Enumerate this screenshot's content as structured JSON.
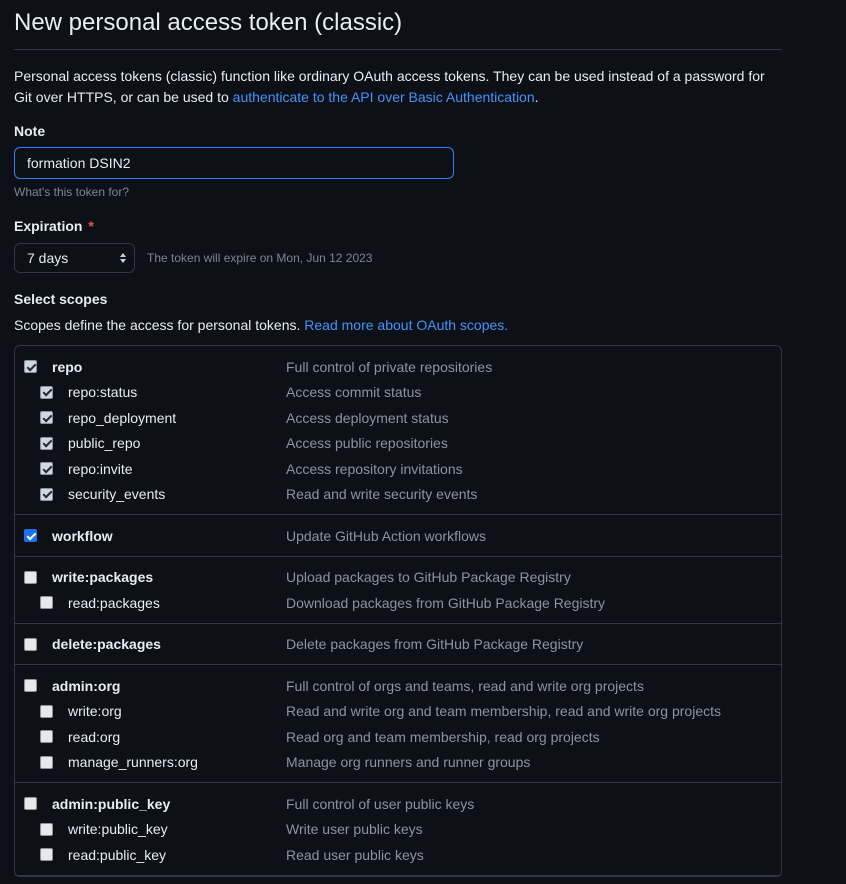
{
  "page": {
    "title": "New personal access token (classic)",
    "intro_text": "Personal access tokens (classic) function like ordinary OAuth access tokens. They can be used instead of a password for Git over HTTPS, or can be used to ",
    "intro_link": "authenticate to the API over Basic Authentication",
    "intro_end": "."
  },
  "note": {
    "label": "Note",
    "value": "formation DSIN2",
    "hint": "What's this token for?"
  },
  "expiration": {
    "label": "Expiration",
    "required_mark": "*",
    "selected": "7 days",
    "note": "The token will expire on Mon, Jun 12 2023"
  },
  "scopes": {
    "label": "Select scopes",
    "desc": "Scopes define the access for personal tokens. ",
    "link": "Read more about OAuth scopes.",
    "groups": [
      {
        "parent": {
          "name": "repo",
          "desc": "Full control of private repositories",
          "checked": true
        },
        "children": [
          {
            "name": "repo:status",
            "desc": "Access commit status",
            "checked": true
          },
          {
            "name": "repo_deployment",
            "desc": "Access deployment status",
            "checked": true
          },
          {
            "name": "public_repo",
            "desc": "Access public repositories",
            "checked": true
          },
          {
            "name": "repo:invite",
            "desc": "Access repository invitations",
            "checked": true
          },
          {
            "name": "security_events",
            "desc": "Read and write security events",
            "checked": true
          }
        ]
      },
      {
        "parent": {
          "name": "workflow",
          "desc": "Update GitHub Action workflows",
          "checked": true,
          "active": true
        },
        "children": []
      },
      {
        "parent": {
          "name": "write:packages",
          "desc": "Upload packages to GitHub Package Registry",
          "checked": false
        },
        "children": [
          {
            "name": "read:packages",
            "desc": "Download packages from GitHub Package Registry",
            "checked": false
          }
        ]
      },
      {
        "parent": {
          "name": "delete:packages",
          "desc": "Delete packages from GitHub Package Registry",
          "checked": false
        },
        "children": []
      },
      {
        "parent": {
          "name": "admin:org",
          "desc": "Full control of orgs and teams, read and write org projects",
          "checked": false
        },
        "children": [
          {
            "name": "write:org",
            "desc": "Read and write org and team membership, read and write org projects",
            "checked": false
          },
          {
            "name": "read:org",
            "desc": "Read org and team membership, read org projects",
            "checked": false
          },
          {
            "name": "manage_runners:org",
            "desc": "Manage org runners and runner groups",
            "checked": false
          }
        ]
      },
      {
        "parent": {
          "name": "admin:public_key",
          "desc": "Full control of user public keys",
          "checked": false
        },
        "children": [
          {
            "name": "write:public_key",
            "desc": "Write user public keys",
            "checked": false
          },
          {
            "name": "read:public_key",
            "desc": "Read user public keys",
            "checked": false
          }
        ]
      }
    ]
  }
}
